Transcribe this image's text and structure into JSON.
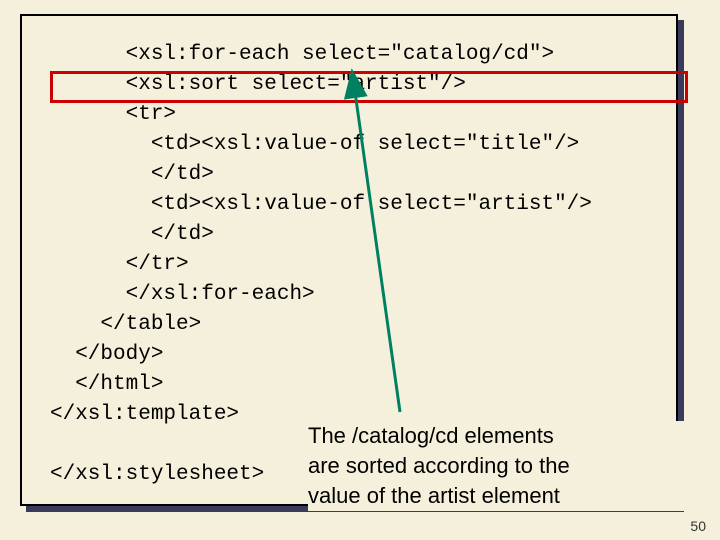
{
  "code": {
    "l1": "      <xsl:for-each select=\"catalog/cd\">",
    "l2": "      <xsl:sort select=\"artist\"/>",
    "l3": "      <tr>",
    "l4": "        <td><xsl:value-of select=\"title\"/>",
    "l5": "        </td>",
    "l6": "        <td><xsl:value-of select=\"artist\"/>",
    "l7": "        </td>",
    "l8": "      </tr>",
    "l9": "      </xsl:for-each>",
    "l10": "    </table>",
    "l11": "  </body>",
    "l12": "  </html>",
    "l13": "</xsl:template>",
    "l14": "",
    "l15": "</xsl:stylesheet>"
  },
  "callout": {
    "line1": "The /catalog/cd elements",
    "line2": "are sorted according to the",
    "line3": "value of the artist element"
  },
  "page": "50"
}
